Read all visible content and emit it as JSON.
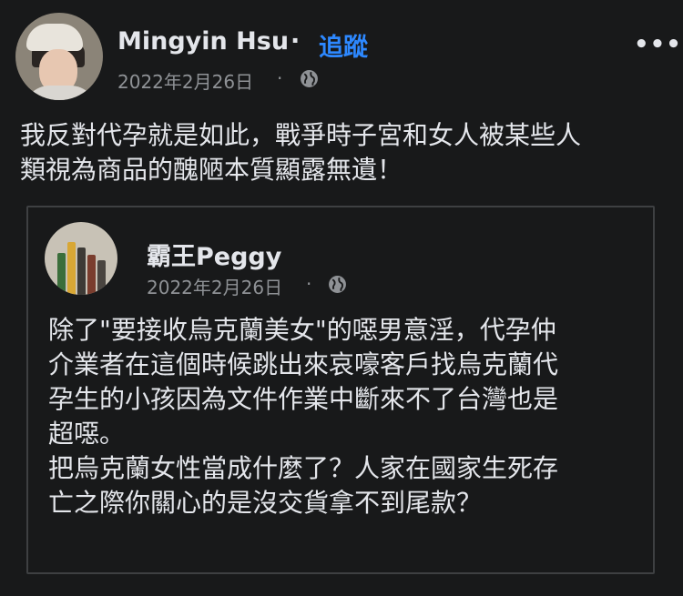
{
  "post": {
    "author": "Mingyin Hsu",
    "separator": "·",
    "follow_label": "追蹤",
    "date": "2022年2月26日",
    "meta_dot": "·",
    "privacy_icon": "globe-icon",
    "more_label": "•••",
    "text_lines": [
      "我反對代孕就是如此，戰爭時子宮和女人被某些人",
      "類視為商品的醜陋本質顯露無遺！"
    ]
  },
  "shared_post": {
    "author": "霸王Peggy",
    "date": "2022年2月26日",
    "meta_dot": "·",
    "privacy_icon": "globe-icon",
    "text_lines": [
      "除了\"要接收烏克蘭美女\"的噁男意淫，代孕仲",
      "介業者在這個時候跳出來哀嚎客戶找烏克蘭代",
      "孕生的小孩因為文件作業中斷來不了台灣也是",
      "超噁。",
      "把烏克蘭女性當成什麼了？人家在國家生死存",
      "亡之際你關心的是沒交貨拿不到尾款？"
    ]
  },
  "colors": {
    "background": "#18191a",
    "text": "#e4e6eb",
    "secondary_text": "#8f9296",
    "link": "#2d88ff",
    "border": "#3e4042"
  }
}
